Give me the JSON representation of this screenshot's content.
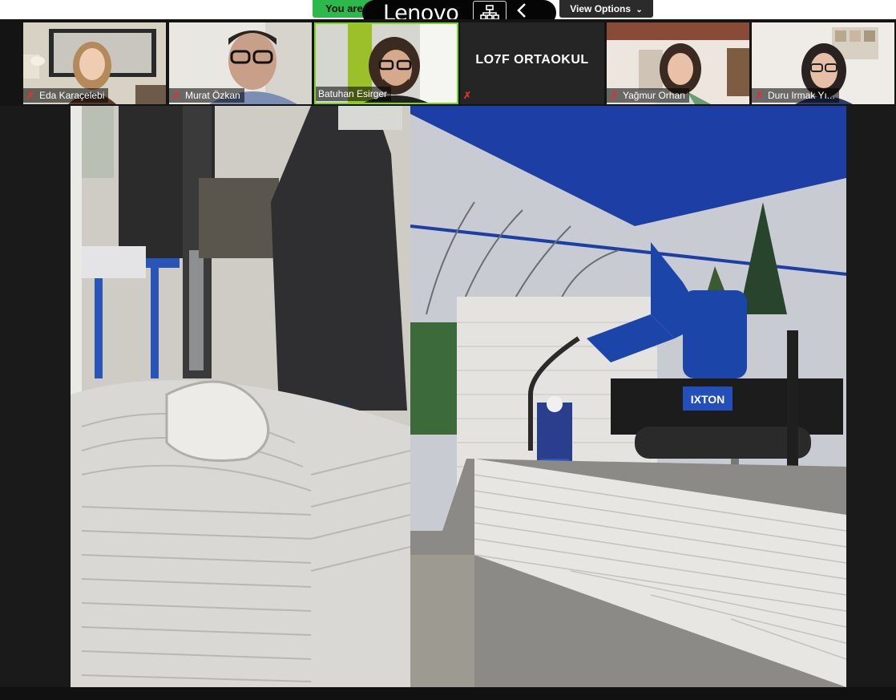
{
  "top": {
    "talking_banner": "You are",
    "lenovo": "Lenovo",
    "view_options": "View Options"
  },
  "participants": [
    {
      "name": "Eda Karaçelebi",
      "muted": true
    },
    {
      "name": "Murat Özkan",
      "muted": true
    },
    {
      "name": "Batuhan Esirger",
      "muted": false,
      "active_speaker": true
    },
    {
      "name": "LO7F ORTAOKUL",
      "muted": true,
      "video_off": true
    },
    {
      "name": "Yağmur Orhan",
      "muted": true
    },
    {
      "name": "Duru Irmak Yı...",
      "muted": true
    }
  ],
  "shared_content": {
    "robot_brand": "IXTON"
  },
  "colors": {
    "talking_green": "#2db84b",
    "muted_red": "#e0302f",
    "active_border": "#7ed321",
    "robot_blue": "#1b45a8"
  }
}
